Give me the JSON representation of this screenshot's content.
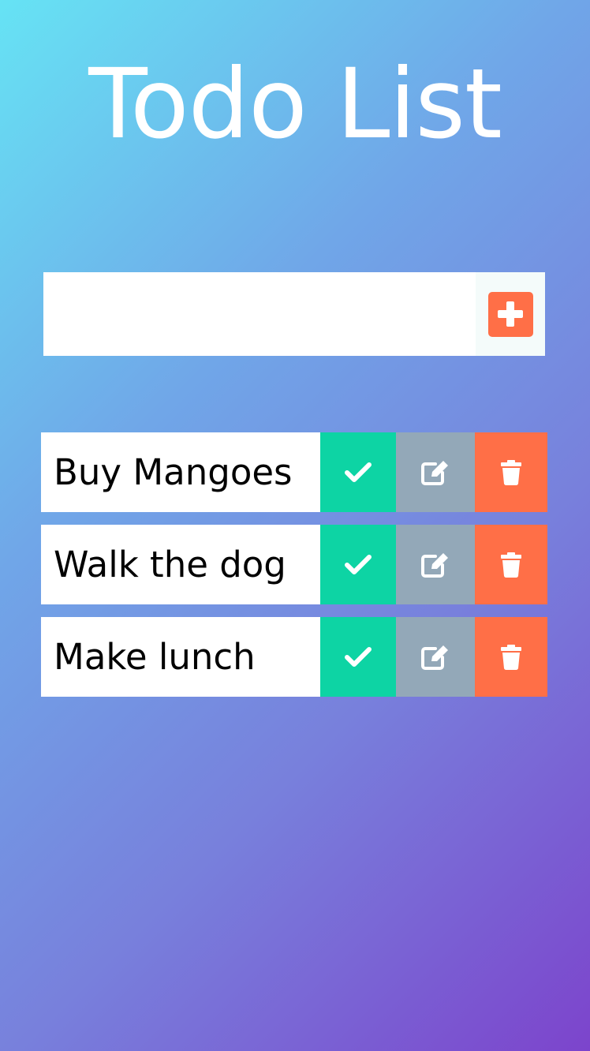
{
  "header": {
    "title": "Todo List"
  },
  "add_form": {
    "input_value": "",
    "input_placeholder": "",
    "add_button_icon": "plus-square-icon"
  },
  "todos": [
    {
      "text": "Buy Mangoes",
      "complete_icon": "check-icon",
      "edit_icon": "edit-icon",
      "delete_icon": "trash-icon"
    },
    {
      "text": "Walk the dog",
      "complete_icon": "check-icon",
      "edit_icon": "edit-icon",
      "delete_icon": "trash-icon"
    },
    {
      "text": "Make lunch",
      "complete_icon": "check-icon",
      "edit_icon": "edit-icon",
      "delete_icon": "trash-icon"
    }
  ],
  "colors": {
    "background_start": "#66e3f4",
    "background_end": "#7c44cc",
    "complete": "#0dd4a4",
    "edit": "#93a8b8",
    "delete": "#ff6f47",
    "add_button": "#ff6f47"
  }
}
